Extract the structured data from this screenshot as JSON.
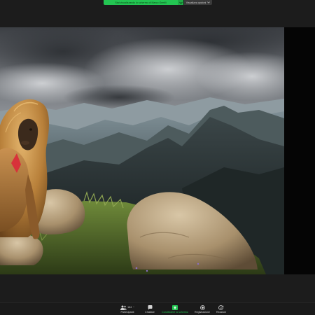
{
  "top_banner": {
    "share_status_text": "Stai visualizzando lo schermo di Marco Gentili",
    "view_options_label": "Visualizza opzioni"
  },
  "toolbar": {
    "participants": {
      "label": "Partecipanti",
      "count": "164"
    },
    "chat": {
      "label": "Chattare"
    },
    "share_screen": {
      "label": "Condividere lo schermo",
      "accent": "#23c552"
    },
    "record": {
      "label": "Registrazione"
    },
    "reactions": {
      "label": "Reazioni"
    }
  },
  "icons": {
    "participants": "people-icon",
    "chat": "chat-bubble-icon",
    "share_screen": "share-arrow-icon",
    "record": "record-icon",
    "reactions": "smile-plus-icon",
    "chevron": "chevron-down-icon"
  },
  "colors": {
    "accent_green": "#23c552",
    "background": "#1c1c1c"
  }
}
